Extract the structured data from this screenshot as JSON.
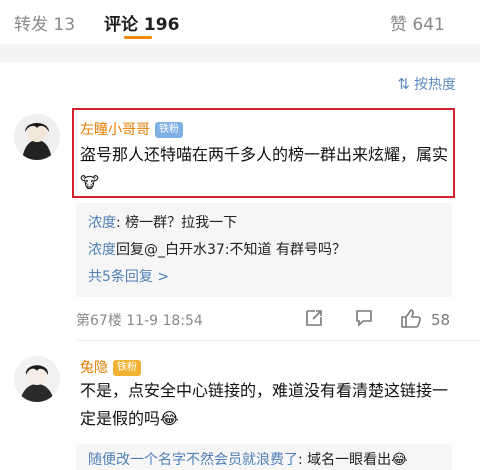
{
  "tabs": {
    "repost": "转发 13",
    "comments": "评论 196",
    "likes": "赞 641"
  },
  "sort": {
    "icon": "sort-icon",
    "label": "按热度"
  },
  "comment1": {
    "author": "左瞳小哥哥",
    "badge": "铁粉",
    "text": "盗号那人还特喵在两千多人的榜一群出来炫耀，属实",
    "emoji": "🐮",
    "replies": [
      {
        "author": "浓度",
        "text": ": 榜一群？拉我一下"
      },
      {
        "author": "浓度",
        "text": "回复@_白开水37:不知道 有群号吗？"
      }
    ],
    "more": "共5条回复 >",
    "meta": "第67楼 11-9 18:54",
    "likes": "58"
  },
  "comment2": {
    "author": "兔隐",
    "badge": "铁粉",
    "text_line1": "不是，点安全中心链接的，难道没有看清楚这链接一",
    "text_line2": "定是假的吗",
    "emoji": "😂",
    "reply_author": "随便改一个名字不然会员就浪费了",
    "reply_text": ": 域名一眼看出",
    "reply_emoji": "😂"
  },
  "colors": {
    "accent": "#f08a00",
    "link": "#4f7fb6",
    "highlight": "#d3202d"
  }
}
